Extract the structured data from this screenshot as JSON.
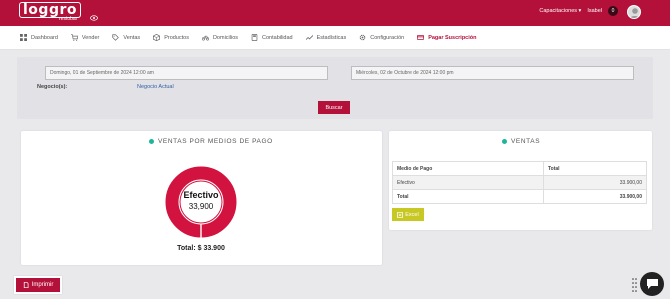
{
  "header": {
    "logo_text": "loggro",
    "logo_sub": "restobar",
    "user_menu": "Capacitaciones",
    "user_name": "Isabel",
    "notifications": "0"
  },
  "nav": [
    {
      "label": "Dashboard",
      "icon": "dashboard-icon"
    },
    {
      "label": "Vender",
      "icon": "cart-icon"
    },
    {
      "label": "Ventas",
      "icon": "tag-icon"
    },
    {
      "label": "Productos",
      "icon": "box-icon"
    },
    {
      "label": "Domicilios",
      "icon": "bike-icon"
    },
    {
      "label": "Contabilidad",
      "icon": "calculator-icon"
    },
    {
      "label": "Estadísticas",
      "icon": "chart-icon"
    },
    {
      "label": "Configuración",
      "icon": "gear-icon"
    },
    {
      "label": "Pagar Suscripción",
      "icon": "card-icon",
      "active": true
    }
  ],
  "filters": {
    "date_from": "Domingo, 01 de Septiembre de 2024 12:00 am",
    "date_to": "Miércoles, 02 de Octubre de 2024 12:00 pm",
    "business_label": "Negocio(s):",
    "business_value": "Negocio Actual",
    "search_label": "Buscar"
  },
  "payment_card": {
    "title": "VENTAS POR MEDIOS DE PAGO",
    "slice_label": "Efectivo",
    "slice_value": "33,900",
    "total": "Total: $ 33.900"
  },
  "chart_data": {
    "type": "pie",
    "categories": [
      "Efectivo"
    ],
    "values": [
      33900
    ],
    "title": "VENTAS POR MEDIOS DE PAGO",
    "colors": [
      "#d3133f"
    ]
  },
  "sales_card": {
    "title": "VENTAS",
    "columns": [
      "Medio de Pago",
      "Total"
    ],
    "rows": [
      [
        "Efectivo",
        "33.900,00"
      ]
    ],
    "total_row": [
      "Total",
      "33.900,00"
    ],
    "excel_label": "Excel"
  },
  "print_label": "Imprimir",
  "colors": {
    "brand": "#b3103a",
    "accent": "#1fb59a",
    "excel": "#c8c824"
  }
}
